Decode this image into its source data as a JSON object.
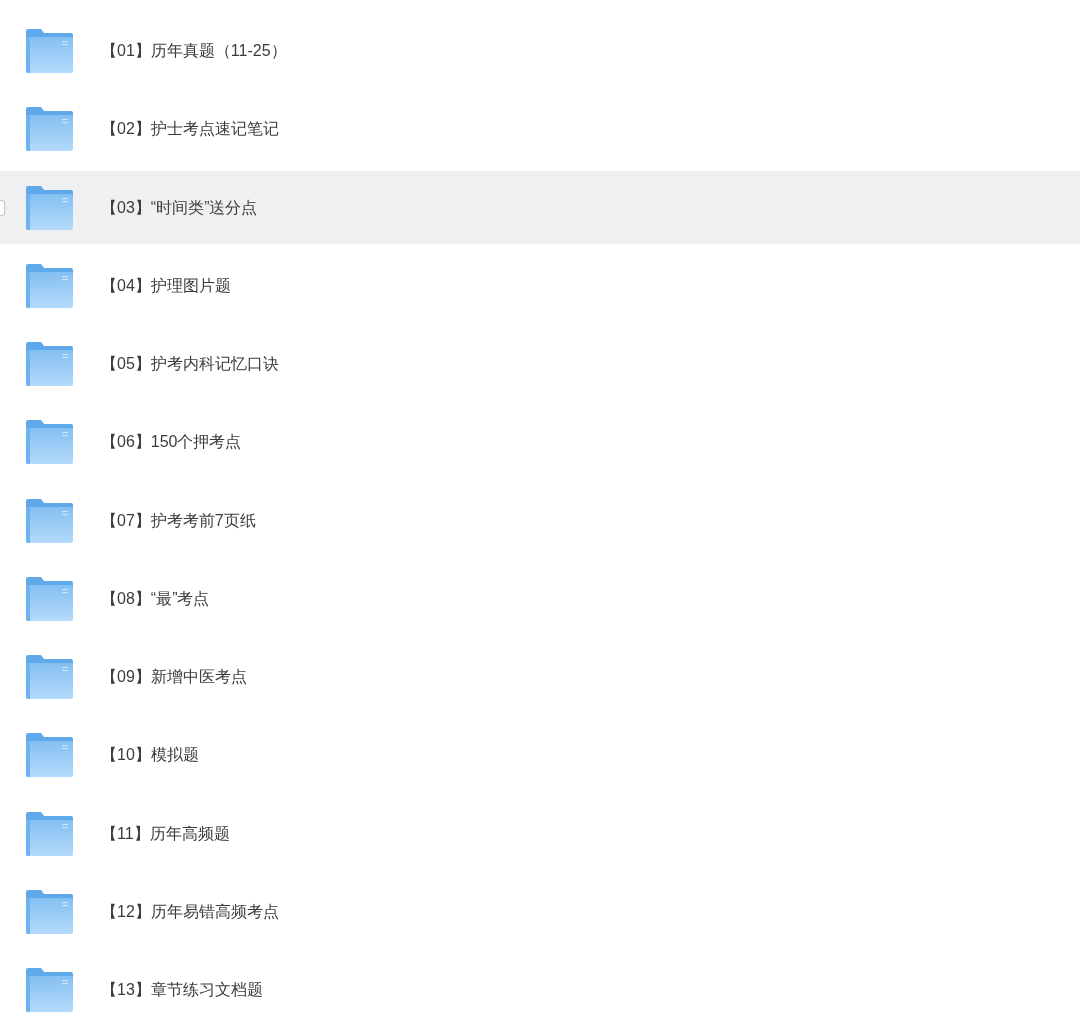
{
  "folders": [
    {
      "name": "【01】历年真题（11-25）",
      "highlighted": false,
      "checked": false
    },
    {
      "name": "【02】护士考点速记笔记",
      "highlighted": false,
      "checked": false
    },
    {
      "name": "【03】“时间类”送分点",
      "highlighted": true,
      "checked": false
    },
    {
      "name": "【04】护理图片题",
      "highlighted": false,
      "checked": false
    },
    {
      "name": "【05】护考内科记忆口诀",
      "highlighted": false,
      "checked": false
    },
    {
      "name": "【06】150个押考点",
      "highlighted": false,
      "checked": false
    },
    {
      "name": "【07】护考考前7页纸",
      "highlighted": false,
      "checked": false
    },
    {
      "name": "【08】“最”考点",
      "highlighted": false,
      "checked": false
    },
    {
      "name": "【09】新增中医考点",
      "highlighted": false,
      "checked": false
    },
    {
      "name": "【10】模拟题",
      "highlighted": false,
      "checked": false
    },
    {
      "name": "【11】历年高频题",
      "highlighted": false,
      "checked": false
    },
    {
      "name": "【12】历年易错高频考点",
      "highlighted": false,
      "checked": false
    },
    {
      "name": "【13】章节练习文档题",
      "highlighted": false,
      "checked": false
    }
  ]
}
